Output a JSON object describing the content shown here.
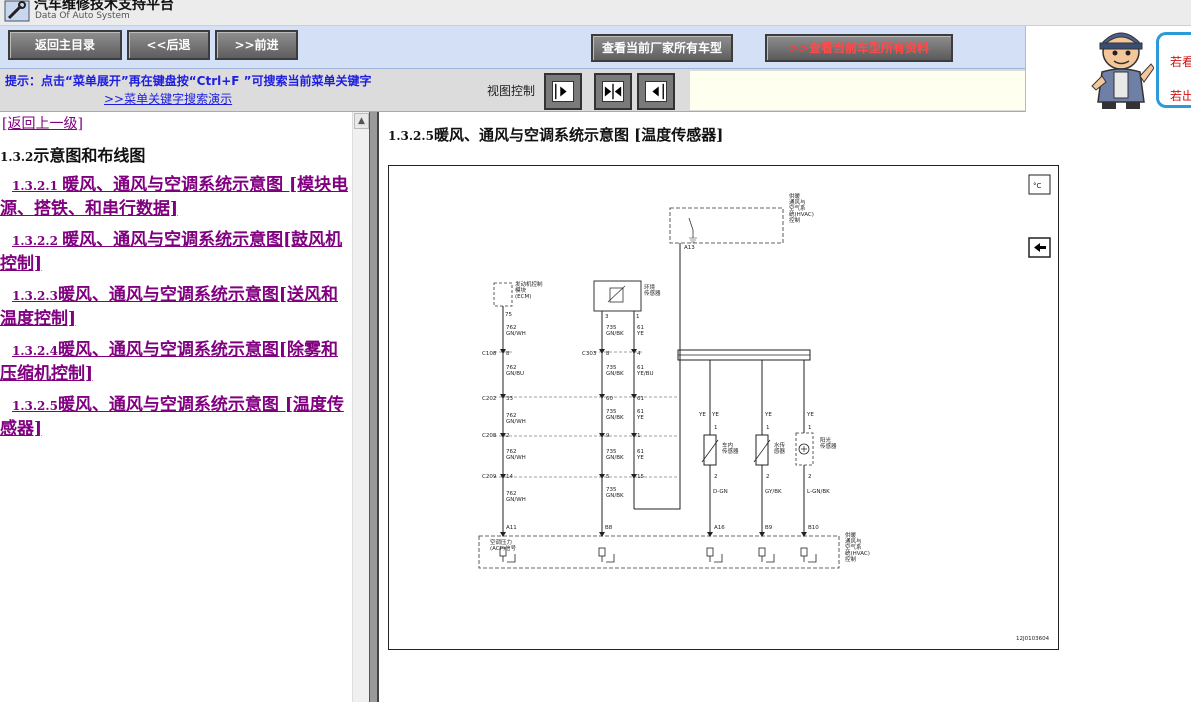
{
  "app": {
    "title": "汽车维修技术支持平台",
    "subtitle": "Data Of Auto System"
  },
  "toolbar": {
    "home_label": "返回主目录",
    "back_label": "<<后退",
    "forward_label": ">>前进",
    "all_models_label": "查看当前厂家所有车型",
    "all_docs_arrows": ">>",
    "all_docs_label": "查看当前车型所有资料"
  },
  "side_panel": {
    "line1": "若看",
    "line2": "若出"
  },
  "hint": {
    "text": "提示：点击“菜单展开”再在键盘按“Ctrl+F ”可搜索当前菜单关键字",
    "demo_link": ">>菜单关键字搜索演示",
    "view_label": "视图控制"
  },
  "left_menu": {
    "up_link": "[返回上一级]",
    "section_num": "1.3.2",
    "section_title": "示意图和布线图",
    "items": [
      {
        "num": "1.3.2.1 ",
        "label": "暖风、通风与空调系统示意图 [模块电源、搭铁、和串行数据]"
      },
      {
        "num": "1.3.2.2 ",
        "label": "暖风、通风与空调系统示意图[鼓风机控制]"
      },
      {
        "num": "1.3.2.3",
        "label": "暖风、通风与空调系统示意图[送风和温度控制]"
      },
      {
        "num": "1.3.2.4",
        "label": "暖风、通风与空调系统示意图[除雾和压缩机控制]"
      },
      {
        "num": "1.3.2.5",
        "label": "暖风、通风与空调系统示意图 [温度传感器]"
      }
    ]
  },
  "content": {
    "title_num": "1.3.2.5",
    "title": "暖风、通风与空调系统示意图 [温度传感器]"
  },
  "diagram": {
    "hvac_label_top": [
      "供暖",
      "通风与",
      "空气系",
      "统(HVAC)",
      "控制"
    ],
    "hvac_pin_top": "A13",
    "ecm_label": [
      "发动机控制",
      "模块",
      "(ECM)"
    ],
    "ecm_pin": "75",
    "ambient_sensor_label": [
      "环境",
      "传感器"
    ],
    "ambient_pins": [
      "3",
      "1"
    ],
    "wire_a_ecm": [
      "762",
      "GN/WH"
    ],
    "wire_a_c108": [
      "762",
      "GN/BU"
    ],
    "wire_a_c202": [
      "762",
      "GN/WH"
    ],
    "wire_a_c208": [
      "762",
      "GN/WH"
    ],
    "wire_a_c209": [
      "762",
      "GN/WH"
    ],
    "wire_b_top": [
      "735",
      "GN/BK"
    ],
    "wire_b_2": [
      "735",
      "GN/BK"
    ],
    "wire_b_3": [
      "735",
      "GN/BK"
    ],
    "wire_b_4": [
      "735",
      "GN/BK"
    ],
    "wire_b_5": [
      "735",
      "GN/BK"
    ],
    "wire_b_6": [
      "735",
      "GN/BK"
    ],
    "wire_c_top": [
      "61",
      "YE"
    ],
    "wire_c_2": [
      "61",
      "YE/BU"
    ],
    "wire_c_3": [
      "61",
      "YE"
    ],
    "wire_c_4": [
      "61",
      "YE"
    ],
    "wire_c_5": [
      "61",
      "YE"
    ],
    "connectors": [
      "C108",
      "C303",
      "C202",
      "C208",
      "C209"
    ],
    "pins_a": [
      "8",
      "33",
      "2",
      "14"
    ],
    "pins_b": [
      "8",
      "60",
      "9",
      "5"
    ],
    "pins_c": [
      "4",
      "61",
      "1",
      "15"
    ],
    "sensor_wire_labels": [
      "YE",
      "YE",
      "YE",
      "YE"
    ],
    "cabin_sensor_label": [
      "车内",
      "传感器"
    ],
    "water_sensor_label": [
      "水传",
      "感器"
    ],
    "sun_sensor_label": [
      "阳光",
      "传感器"
    ],
    "sensor_pin_top": [
      "1",
      "1",
      "1"
    ],
    "sensor_pin_bottom": [
      "2",
      "2",
      "2"
    ],
    "sensor_bottom_wires": [
      "D-GN",
      "GY/BK",
      "L-GN/BK"
    ],
    "bottom_pins": [
      "A11",
      "B8",
      "A16",
      "B9",
      "B10"
    ],
    "acp_label": [
      "空调压力",
      "(ACP)信号"
    ],
    "hvac_label_bottom": [
      "供暖",
      "通风与",
      "空气系",
      "统(HVAC)",
      "控制"
    ],
    "figure_id": "12J0103604",
    "temp_unit": "°C"
  },
  "colors": {
    "toolbar_bg": "#d4e0f5",
    "link_visited": "#800080",
    "hint_blue": "#1d1de0",
    "docs_red": "#ff4a4a"
  }
}
